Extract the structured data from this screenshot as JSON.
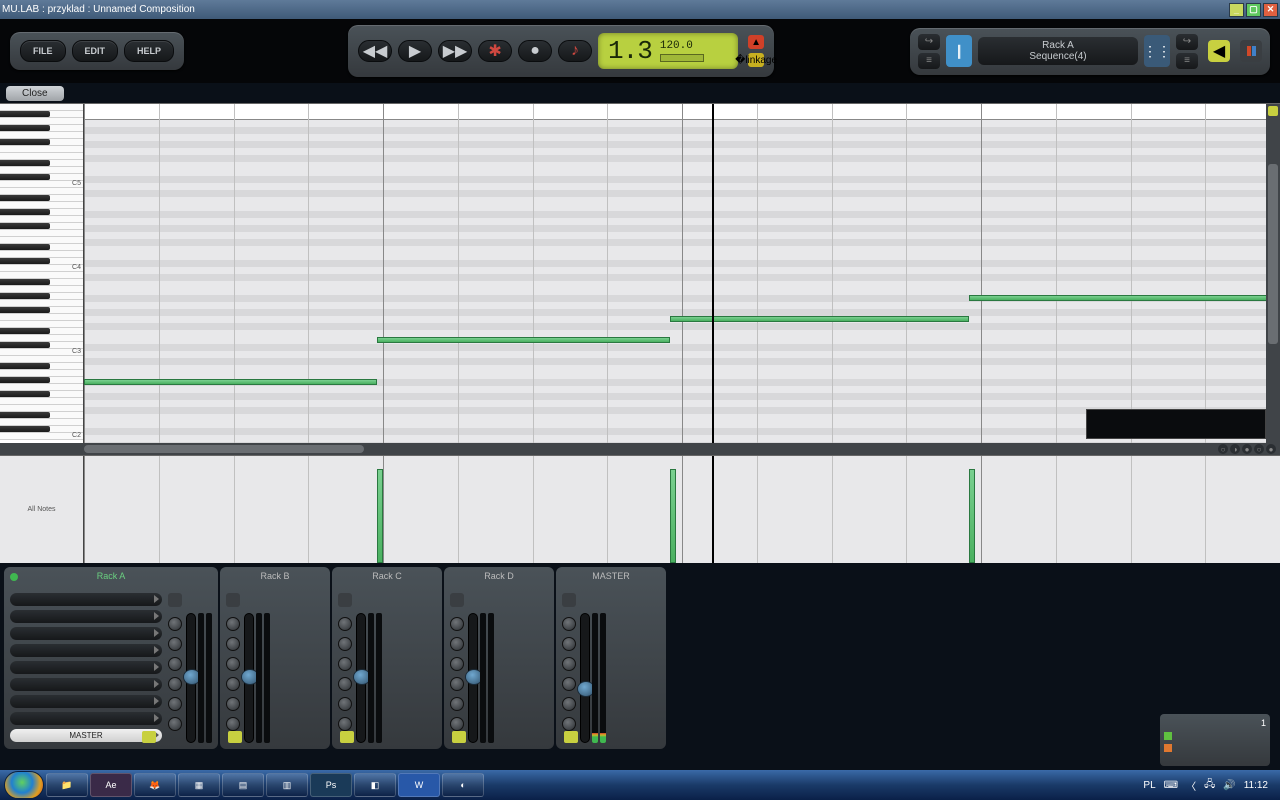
{
  "window": {
    "title": "MU.LAB : przyklad : Unnamed Composition"
  },
  "menu": {
    "file": "FILE",
    "edit": "EDIT",
    "help": "HELP"
  },
  "transport": {
    "position": "1.3",
    "tempo": "120.0"
  },
  "rack": {
    "name": "Rack A",
    "sequence": "Sequence(4)"
  },
  "editor": {
    "close": "Close",
    "velocity_label": "All Notes"
  },
  "piano": {
    "octave_labels": [
      "C5",
      "C4",
      "C3",
      "C2"
    ],
    "notes": [
      {
        "left_pct": 0,
        "width_pct": 24.5,
        "row": 37
      },
      {
        "left_pct": 24.5,
        "width_pct": 24.5,
        "row": 31
      },
      {
        "left_pct": 49,
        "width_pct": 25,
        "row": 28
      },
      {
        "left_pct": 74,
        "width_pct": 25.3,
        "row": 25
      }
    ],
    "playhead_pct": 52.5,
    "velocity_bars": [
      {
        "left_pct": 24.5,
        "h_pct": 88
      },
      {
        "left_pct": 49,
        "h_pct": 88
      },
      {
        "left_pct": 74,
        "h_pct": 88
      }
    ]
  },
  "mixer": {
    "channels": [
      {
        "name": "Rack A",
        "active": true,
        "fader": 0.55,
        "meter": 0,
        "wide": true,
        "out": "MASTER"
      },
      {
        "name": "Rack B",
        "active": false,
        "fader": 0.55,
        "meter": 0,
        "wide": false
      },
      {
        "name": "Rack C",
        "active": false,
        "fader": 0.55,
        "meter": 0,
        "wide": false
      },
      {
        "name": "Rack D",
        "active": false,
        "fader": 0.55,
        "meter": 0,
        "wide": false
      },
      {
        "name": "MASTER",
        "active": false,
        "fader": 0.45,
        "meter": 0.08,
        "wide": false
      }
    ]
  },
  "tray_text": "1",
  "taskbar": {
    "lang": "PL",
    "clock": "11:12"
  }
}
